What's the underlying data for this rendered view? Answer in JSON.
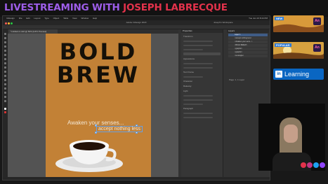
{
  "banner": {
    "title_part1": "LIVESTREAMING WITH ",
    "title_part2": "JOSEPH LABRECQUE",
    "color_part1": "#9d5de8",
    "color_part2": "#e3324b"
  },
  "app": {
    "name": "InDesign",
    "menu": [
      "InDesign",
      "File",
      "Edit",
      "Layout",
      "Type",
      "Object",
      "Table",
      "View",
      "Window",
      "Help"
    ],
    "clock": "Tue Jun 23 8:44 PM",
    "window_title": "Adobe InDesign 2020",
    "workspace": "Joseph's Workspace",
    "doc_tab": "*untitled-1.indd @ 50% [GPU Preview]"
  },
  "document": {
    "line1": "BOLD",
    "line2": "BREW",
    "tagline1": "Awaken your senses...",
    "tagline2": "accept nothing less",
    "page_color": "#c28136",
    "text_color": "#151008"
  },
  "properties_panel": {
    "title": "Properties",
    "sections": [
      "Transform",
      "Character",
      "Paragraph"
    ],
    "label_appearance": "Appearance",
    "label_text_frame": "Text Frame",
    "label_character": "Character",
    "font": "Raleway",
    "font_style": "Light"
  },
  "layers_panel": {
    "title": "Layers",
    "items": [
      "Layer 1",
      "<accept nothing less>",
      "<Awaken your sens...>",
      "<BOLD BREW>",
      "<graphic>",
      "<graphic>",
      "<rectangle>"
    ],
    "footer": "Page: 1, 1 Layer"
  },
  "sidebar": {
    "thumb1_badge": "NEW",
    "thumb1_app": "An",
    "thumb2_badge": "POPULAR",
    "thumb2_app": "An",
    "linkedin_mark": "in",
    "linkedin_label": "Learning",
    "linkedin_color": "#0a66c2"
  }
}
